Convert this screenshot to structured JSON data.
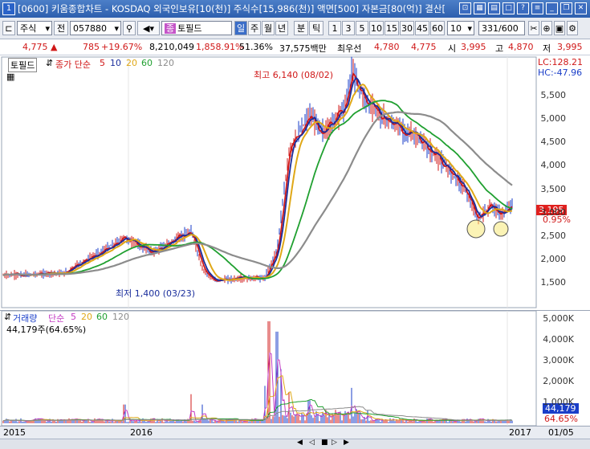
{
  "window": {
    "app_num": "1",
    "title": "[0600] 키움종합차트 - KOSDAQ 외국인보유[10(천)] 주식수[15,986(천)] 액면[500] 자본금[80(억)] 결산[",
    "icons": [
      "pin-icon",
      "grid-icon",
      "doc-icon",
      "window-icon",
      "help-icon",
      "menu-icon",
      "minimize-icon",
      "restore-icon",
      "close-icon"
    ]
  },
  "toolbar": {
    "market": "주식",
    "prev_label": "전",
    "code": "057880",
    "stock_name": "토필드",
    "day_tab": "일",
    "week_tab": "주",
    "month_tab": "월",
    "year_tab": "년",
    "minute_tab": "분",
    "tick_tab": "틱",
    "intervals": [
      "1",
      "3",
      "5",
      "10",
      "15",
      "30",
      "45",
      "60"
    ],
    "interval_value": "10",
    "count": "331",
    "count_total": "/600"
  },
  "quote": {
    "price": "4,775",
    "change": "785",
    "change_pct": "+19.67%",
    "volume": "8,210,049",
    "volume_pct": "1,858.91%",
    "turnover": "51.36%",
    "amount": "37,575백만",
    "best_ask_label": "최우선",
    "best_ask": "4,780",
    "best_bid": "4,775",
    "open_label": "시",
    "open": "3,995",
    "high_label": "고",
    "high": "4,870",
    "low_label": "저",
    "low": "3,995"
  },
  "price_panel": {
    "name_tag": "토필드",
    "ma_label": "종가 단순",
    "ma_periods": [
      "5",
      "10",
      "20",
      "60",
      "120"
    ],
    "lc": "LC:128.21",
    "hc": "HC:-47.96",
    "high_note": "최고 6,140 (08/02)",
    "low_note": "최저 1,400 (03/23)",
    "current_price": "3,195",
    "current_pct": "0.95%",
    "yticks": [
      "5,500",
      "5,000",
      "4,500",
      "4,000",
      "3,500",
      "3,000",
      "2,500",
      "2,000",
      "1,500"
    ]
  },
  "volume_panel": {
    "name": "거래량",
    "ma_label": "단순",
    "ma_periods": [
      "5",
      "20",
      "60",
      "120"
    ],
    "info": "44,179주(64.65%)",
    "yticks": [
      "5,000K",
      "4,000K",
      "3,000K",
      "2,000K",
      "1,000K"
    ],
    "current": "44,179",
    "current_pct": "64.65%"
  },
  "xaxis": {
    "labels": [
      "2015",
      "2016",
      "2017",
      "01/05"
    ]
  },
  "colors": {
    "ma5": "#d01818",
    "ma10": "#1a2e9c",
    "ma20": "#e0a818",
    "ma60": "#20a030",
    "ma120": "#8c8c8c"
  }
}
